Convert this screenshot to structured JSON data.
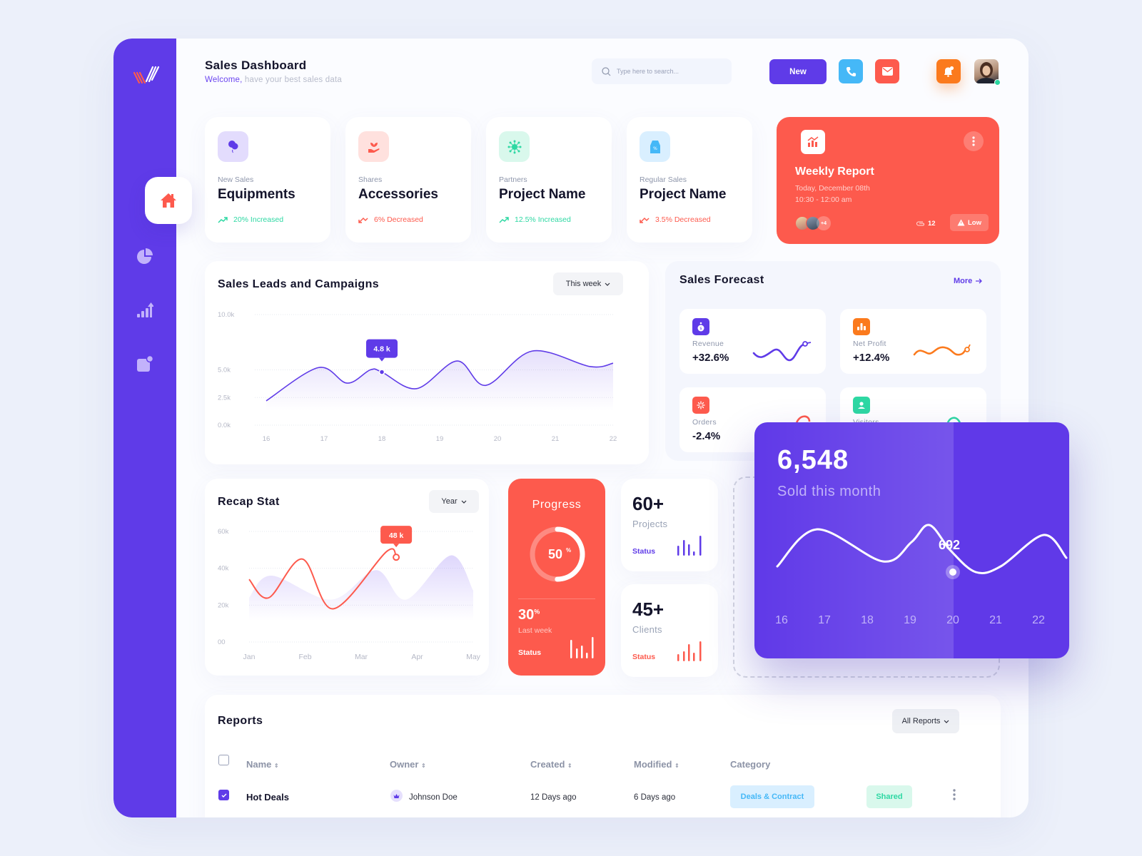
{
  "header": {
    "title": "Sales Dashboard",
    "welcome": "Welcome,",
    "subtitle": " have your best sales data",
    "search_placeholder": "Type here to search...",
    "new_label": "New"
  },
  "sidebar": {
    "items": [
      {
        "name": "home",
        "active": true
      },
      {
        "name": "pie-chart",
        "active": false
      },
      {
        "name": "growth",
        "active": false
      },
      {
        "name": "notifications",
        "active": false
      }
    ]
  },
  "stat_cards": [
    {
      "label": "New Sales",
      "value": "Equipments",
      "trend": "20% Increased",
      "direction": "up"
    },
    {
      "label": "Shares",
      "value": "Accessories",
      "trend": "6% Decreased",
      "direction": "down"
    },
    {
      "label": "Partners",
      "value": "Project Name",
      "trend": "12.5% Increased",
      "direction": "up"
    },
    {
      "label": "Regular Sales",
      "value": "Project Name",
      "trend": "3.5% Decreased",
      "direction": "down"
    }
  ],
  "weekly_report": {
    "title": "Weekly Report",
    "date": "Today, December 08th",
    "time": "10:30 - 12:00 am",
    "extra_members": "+4",
    "attachments": "12",
    "priority": "Low"
  },
  "sales_leads": {
    "title": "Sales Leads and Campaigns",
    "filter": "This week",
    "tooltip": "4.8 k"
  },
  "sales_forecast": {
    "title": "Sales Forecast",
    "more": "More",
    "items": [
      {
        "label": "Revenue",
        "value": "+32.6%",
        "color": "#5f3be8"
      },
      {
        "label": "Net Profit",
        "value": "+12.4%",
        "color": "#fb7a1d"
      },
      {
        "label": "Orders",
        "value": "-2.4%",
        "color": "#fd5a4d"
      },
      {
        "label": "Visitors",
        "value": "",
        "color": "#2ed8a3"
      }
    ]
  },
  "recap": {
    "title": "Recap Stat",
    "filter": "Year",
    "tooltip": "48 k"
  },
  "progress": {
    "title": "Progress",
    "percent": "50",
    "percent_value": 0.5,
    "unit": "%",
    "last_week": "30",
    "last_week_label": "Last week",
    "status": "Status"
  },
  "mini_stats": [
    {
      "value": "60+",
      "label": "Projects",
      "status": "Status",
      "color": "#5f3be8"
    },
    {
      "value": "45+",
      "label": "Clients",
      "status": "Status",
      "color": "#fd5a4d"
    }
  ],
  "sold": {
    "value": "6,548",
    "label": "Sold this month",
    "highlight": "692"
  },
  "reports": {
    "title": "Reports",
    "filter": "All Reports",
    "columns": [
      "Name",
      "Owner",
      "Created",
      "Modified",
      "Category"
    ],
    "rows": [
      {
        "name": "Hot Deals",
        "owner": "Johnson Doe",
        "created": "12 Days ago",
        "modified": "6 Days ago",
        "category": "Deals & Contract",
        "status": "Shared",
        "checked": true
      }
    ]
  },
  "chart_data": [
    {
      "type": "area",
      "title": "Sales Leads and Campaigns",
      "x": [
        "16",
        "17",
        "18",
        "19",
        "20",
        "21",
        "22"
      ],
      "yticks": [
        "0.0k",
        "2.5k",
        "5.0k",
        "10.0k"
      ],
      "ylim": [
        0,
        10000
      ],
      "series": [
        {
          "name": "Leads",
          "points": [
            [
              16,
              2200
            ],
            [
              16.9,
              5200
            ],
            [
              17.4,
              3800
            ],
            [
              17.8,
              5000
            ],
            [
              18,
              4800
            ],
            [
              18.6,
              3300
            ],
            [
              19.3,
              5800
            ],
            [
              19.8,
              3600
            ],
            [
              20.6,
              6700
            ],
            [
              21.6,
              5300
            ],
            [
              22,
              5600
            ]
          ]
        }
      ],
      "annotation": {
        "x": 18,
        "label": "4.8 k"
      },
      "color": "#5f3be8"
    },
    {
      "type": "line",
      "title": "Recap Stat",
      "x": [
        "Jan",
        "Feb",
        "Mar",
        "Apr",
        "May"
      ],
      "yticks": [
        "00",
        "20k",
        "40k",
        "60k"
      ],
      "ylim": [
        0,
        60000
      ],
      "series": [
        {
          "name": "Line",
          "color": "#fd5a4d",
          "points": [
            [
              0,
              34000
            ],
            [
              0.35,
              24000
            ],
            [
              0.95,
              45000
            ],
            [
              1.5,
              18000
            ],
            [
              2.45,
              49000
            ],
            [
              2.6,
              46000
            ]
          ]
        },
        {
          "name": "Area",
          "color": "#d9d1fb",
          "points": [
            [
              0,
              24000
            ],
            [
              0.3,
              36000
            ],
            [
              1.1,
              23000
            ],
            [
              1.7,
              39000
            ],
            [
              2.1,
              23000
            ],
            [
              2.7,
              47000
            ],
            [
              3,
              28000
            ]
          ]
        }
      ],
      "annotation": {
        "x": "Apr",
        "label": "48 k"
      }
    },
    {
      "type": "line",
      "title": "Sold this month",
      "x": [
        "16",
        "17",
        "18",
        "19",
        "20",
        "21",
        "22"
      ],
      "series": [
        {
          "name": "Sold",
          "points": [
            [
              0,
              650
            ],
            [
              0.55,
              760
            ],
            [
              1.95,
              680
            ],
            [
              2.8,
              780
            ],
            [
              4,
              692
            ],
            [
              5.8,
              760
            ],
            [
              6.2,
              670
            ]
          ]
        }
      ],
      "annotation": {
        "x": "20",
        "label": "692"
      }
    }
  ]
}
